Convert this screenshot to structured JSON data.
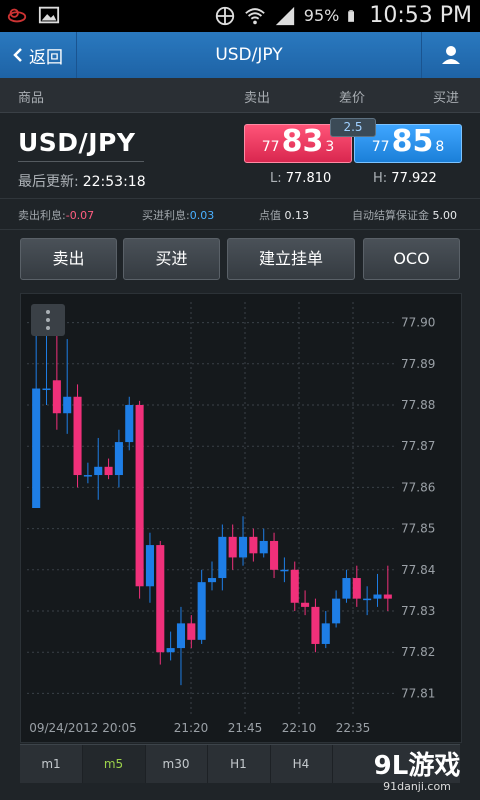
{
  "status_bar": {
    "battery": "95%",
    "time": "10:53 PM"
  },
  "app_bar": {
    "back_label": "返回",
    "title": "USD/JPY"
  },
  "column_headers": {
    "product": "商品",
    "sell": "卖出",
    "spread": "差价",
    "buy": "买进"
  },
  "quote": {
    "symbol": "USD/JPY",
    "last_update_label": "最后更新:",
    "last_update_time": "22:53:18",
    "sell": {
      "prefix": "77",
      "big": "83",
      "pip": "3"
    },
    "buy": {
      "prefix": "77",
      "big": "85",
      "pip": "8"
    },
    "spread": "2.5",
    "low_label": "L:",
    "low": "77.810",
    "high_label": "H:",
    "high": "77.922"
  },
  "info": {
    "sell_interest_label": "卖出利息:",
    "sell_interest": "-0.07",
    "buy_interest_label": "买进利息:",
    "buy_interest": "0.03",
    "pip_value_label": "点值",
    "pip_value": "0.13",
    "margin_label": "自动结算保证金",
    "margin": "5.00"
  },
  "actions": {
    "sell": "卖出",
    "buy": "买进",
    "create_order": "建立挂单",
    "oco": "OCO"
  },
  "timeframes": [
    "m1",
    "m5",
    "m30",
    "H1",
    "H4"
  ],
  "active_timeframe": "m5",
  "watermark": {
    "line1": "9L游戏",
    "line2": "91danji.com"
  },
  "colors": {
    "bull": "#1e7ee6",
    "bear": "#f0307a",
    "sell_box": "#e42f55",
    "buy_box": "#2a8ef0",
    "accent_green": "#9cd34b"
  },
  "chart_data": {
    "type": "candlestick",
    "y_ticks": [
      "77.90",
      "77.89",
      "77.88",
      "77.87",
      "77.86",
      "77.85",
      "77.84",
      "77.83",
      "77.82",
      "77.81"
    ],
    "ylim": [
      77.805,
      77.905
    ],
    "x_ticks": [
      "09/24/2012 20:05",
      "21:20",
      "21:45",
      "22:10",
      "22:35"
    ],
    "candles": [
      {
        "o": 77.855,
        "c": 77.884,
        "h": 77.899,
        "l": 77.855
      },
      {
        "o": 77.884,
        "c": 77.884,
        "h": 77.897,
        "l": 77.88
      },
      {
        "o": 77.886,
        "c": 77.878,
        "h": 77.899,
        "l": 77.874
      },
      {
        "o": 77.878,
        "c": 77.882,
        "h": 77.896,
        "l": 77.873
      },
      {
        "o": 77.882,
        "c": 77.863,
        "h": 77.885,
        "l": 77.86
      },
      {
        "o": 77.863,
        "c": 77.863,
        "h": 77.866,
        "l": 77.861
      },
      {
        "o": 77.863,
        "c": 77.865,
        "h": 77.872,
        "l": 77.857
      },
      {
        "o": 77.865,
        "c": 77.863,
        "h": 77.867,
        "l": 77.862
      },
      {
        "o": 77.863,
        "c": 77.871,
        "h": 77.874,
        "l": 77.86
      },
      {
        "o": 77.871,
        "c": 77.88,
        "h": 77.882,
        "l": 77.869
      },
      {
        "o": 77.88,
        "c": 77.836,
        "h": 77.881,
        "l": 77.833
      },
      {
        "o": 77.836,
        "c": 77.846,
        "h": 77.849,
        "l": 77.832
      },
      {
        "o": 77.846,
        "c": 77.82,
        "h": 77.847,
        "l": 77.817
      },
      {
        "o": 77.82,
        "c": 77.821,
        "h": 77.825,
        "l": 77.818
      },
      {
        "o": 77.821,
        "c": 77.827,
        "h": 77.831,
        "l": 77.812
      },
      {
        "o": 77.827,
        "c": 77.823,
        "h": 77.829,
        "l": 77.821
      },
      {
        "o": 77.823,
        "c": 77.837,
        "h": 77.84,
        "l": 77.822
      },
      {
        "o": 77.837,
        "c": 77.838,
        "h": 77.842,
        "l": 77.835
      },
      {
        "o": 77.838,
        "c": 77.848,
        "h": 77.851,
        "l": 77.835
      },
      {
        "o": 77.848,
        "c": 77.843,
        "h": 77.851,
        "l": 77.84
      },
      {
        "o": 77.843,
        "c": 77.848,
        "h": 77.853,
        "l": 77.841
      },
      {
        "o": 77.848,
        "c": 77.844,
        "h": 77.85,
        "l": 77.842
      },
      {
        "o": 77.844,
        "c": 77.847,
        "h": 77.85,
        "l": 77.843
      },
      {
        "o": 77.847,
        "c": 77.84,
        "h": 77.849,
        "l": 77.838
      },
      {
        "o": 77.84,
        "c": 77.84,
        "h": 77.843,
        "l": 77.837
      },
      {
        "o": 77.84,
        "c": 77.832,
        "h": 77.842,
        "l": 77.83
      },
      {
        "o": 77.832,
        "c": 77.831,
        "h": 77.835,
        "l": 77.829
      },
      {
        "o": 77.831,
        "c": 77.822,
        "h": 77.833,
        "l": 77.82
      },
      {
        "o": 77.822,
        "c": 77.827,
        "h": 77.83,
        "l": 77.821
      },
      {
        "o": 77.827,
        "c": 77.833,
        "h": 77.835,
        "l": 77.826
      },
      {
        "o": 77.833,
        "c": 77.838,
        "h": 77.84,
        "l": 77.832
      },
      {
        "o": 77.838,
        "c": 77.833,
        "h": 77.841,
        "l": 77.831
      },
      {
        "o": 77.833,
        "c": 77.833,
        "h": 77.836,
        "l": 77.829
      },
      {
        "o": 77.833,
        "c": 77.834,
        "h": 77.839,
        "l": 77.831
      },
      {
        "o": 77.834,
        "c": 77.833,
        "h": 77.841,
        "l": 77.83
      }
    ]
  }
}
